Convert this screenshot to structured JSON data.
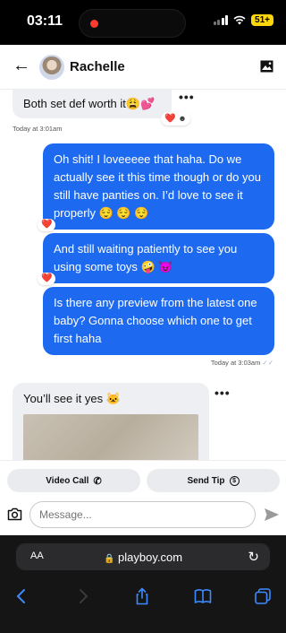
{
  "status": {
    "time": "03:11",
    "battery": "51+"
  },
  "header": {
    "back_icon": "arrow-left-icon",
    "name": "Rachelle",
    "gallery_icon": "image-icon"
  },
  "messages": [
    {
      "from": "them",
      "text": "Both set def worth it😩💕",
      "time": "Today at 3:01am",
      "reaction": "❤️"
    },
    {
      "from": "me",
      "text": "Oh shit! I loveeeee that haha. Do we actually see it this time though or do you still have panties on. I’d love to see it properly 😌 😌 😌",
      "reaction": "❤️"
    },
    {
      "from": "me",
      "text": "And still waiting patiently to see you using some toys 🤪 😈",
      "reaction": "❤️"
    },
    {
      "from": "me",
      "text": "Is there any preview from the latest one baby? Gonna choose which one to get first haha",
      "time": "Today at 3:03am"
    },
    {
      "from": "them",
      "text": "You’ll see it yes 🐱"
    }
  ],
  "actions": {
    "video_call": "Video Call",
    "send_tip": "Send Tip"
  },
  "composer": {
    "placeholder": "Message..."
  },
  "browser": {
    "aa": "AA",
    "url": "playboy.com"
  }
}
